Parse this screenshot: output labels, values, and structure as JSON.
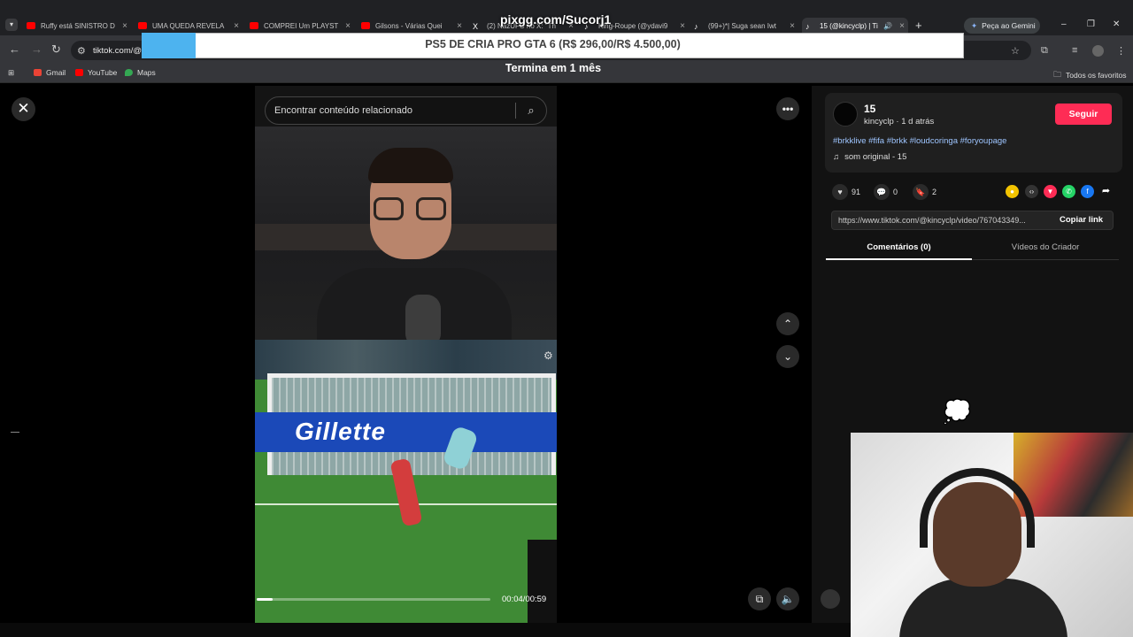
{
  "browser": {
    "tabs": [
      {
        "label": "Ruffy está SINISTRO D",
        "color": "#ff0000"
      },
      {
        "label": "UMA QUEDA REVELA",
        "color": "#ff0000"
      },
      {
        "label": "COMPREI Um PLAYST",
        "color": "#ff0000"
      },
      {
        "label": "Gilsons - Várias Quei",
        "color": "#ff0000"
      },
      {
        "label": "(2) NazUFC no X: \"Th",
        "color": "#ffffff"
      },
      {
        "label": "King-Roupe (@ydavi9",
        "color": "#ffffff"
      },
      {
        "label": "(99+)*| Suga sean Iwt",
        "color": "#ffffff"
      },
      {
        "label": "15 (@kincyclp) | Ti",
        "color": "#ffffff"
      }
    ],
    "new_tab": "+",
    "gemini_label": "Peça ao Gemini",
    "address": "tiktok.com/@",
    "bookmarks": [
      {
        "label": "Gmail",
        "color": "#ea4335"
      },
      {
        "label": "YouTube",
        "color": "#ff0000"
      },
      {
        "label": "Maps",
        "color": "#34a853"
      }
    ],
    "favorites_label": "Todos os favoritos"
  },
  "overlay": {
    "url": "pixgg.com/Sucorj1",
    "banner": "PS5 DE CRIA PRO GTA 6 (R$ 296,00/R$ 4.500,00)",
    "subtitle": "Termina em 1 mês",
    "goal_progress": 0.066
  },
  "tiktok": {
    "search_placeholder": "Encontrar conteúdo relacionado",
    "board_text": "Gillette",
    "time": "00:04/00:59",
    "progress": 0.068,
    "author": {
      "name": "15",
      "meta": "kincyclp · 1 d atrás"
    },
    "follow_label": "Seguir",
    "hashtags": "#brkklive #fifa #brkk #loudcoringa #foryoupage",
    "sound": "som original - 15",
    "stats": {
      "likes": "91",
      "comments": "0",
      "saves": "2"
    },
    "link": "https://www.tiktok.com/@kincyclp/video/767043349...",
    "copy_link": "Copiar link",
    "tabs": [
      "Comentários (0)",
      "Vídeos do Criador"
    ]
  },
  "colors": {
    "accent": "#fe2c55",
    "banner_accent": "#4db3ef",
    "hashtag": "#9ec5ff"
  }
}
